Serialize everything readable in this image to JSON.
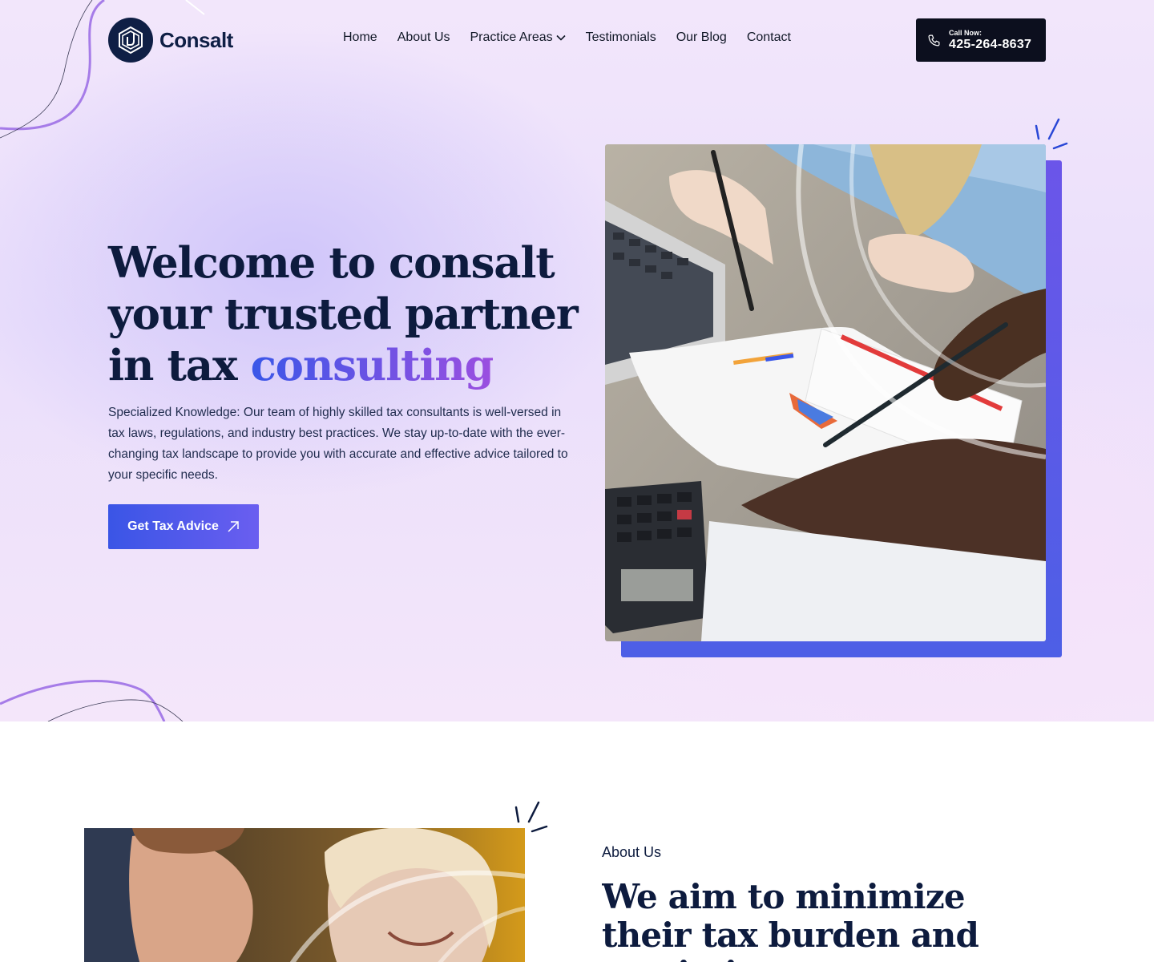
{
  "brand": {
    "name": "Consalt",
    "logo_icon": "hexagon-d-logo"
  },
  "nav": {
    "items": [
      {
        "label": "Home"
      },
      {
        "label": "About Us"
      },
      {
        "label": "Practice Areas",
        "has_dropdown": true
      },
      {
        "label": "Testimonials"
      },
      {
        "label": "Our Blog"
      },
      {
        "label": "Contact"
      }
    ]
  },
  "call": {
    "label": "Call Now:",
    "number": "425-264-8637",
    "icon": "phone-icon"
  },
  "hero": {
    "title_line1": "Welcome to consalt",
    "title_line2": "your trusted partner",
    "title_line3_prefix": "in tax ",
    "title_line3_accent": "consulting",
    "description": "Specialized Knowledge: Our team of highly skilled tax consultants is well-versed in tax laws, regulations, and industry best practices. We stay up-to-date with the ever-changing tax landscape to provide you with accurate and effective advice tailored to your specific needs.",
    "cta_label": "Get Tax Advice",
    "cta_icon": "arrow-up-right-icon"
  },
  "about": {
    "eyebrow": "About Us",
    "title": "We aim to minimize their tax burden and maximize"
  },
  "colors": {
    "navy": "#0d1b3e",
    "accent_blue": "#3a55e6",
    "accent_purple": "#9b4fe0",
    "dark_button": "#0c0f1e"
  }
}
